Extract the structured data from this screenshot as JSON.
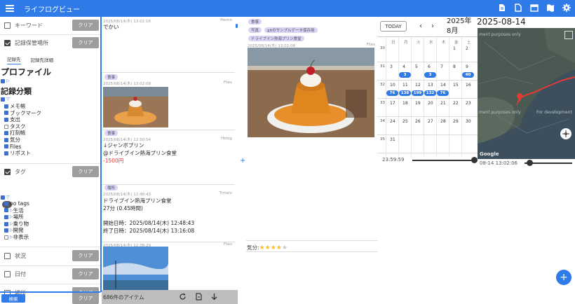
{
  "app": {
    "title": "ライフログビュー"
  },
  "filters": {
    "keyword": {
      "label": "キーワード",
      "checked": false
    },
    "storage": {
      "label": "記録保管場所",
      "checked": true
    },
    "tag": {
      "label": "タグ",
      "checked": true
    },
    "status": {
      "label": "状況",
      "checked": false
    },
    "date": {
      "label": "日付",
      "checked": false
    },
    "place": {
      "label": "場所",
      "checked": false
    },
    "clear_label": "クリア",
    "tab_storage": "記録先",
    "tab_storage_detail": "記録先詳細",
    "profile_heading": "プロファイル",
    "category_heading": "記録分類",
    "categories": [
      "メモ帳",
      "ブックマーク",
      "支出",
      "タスク",
      "打刻帳",
      "気分",
      "Files",
      "リポスト"
    ],
    "tags": [
      "no tags",
      "生活",
      "場所",
      "乗り物",
      "開発",
      "非表示"
    ],
    "search_label": "検索"
  },
  "timeline": {
    "count_label": "686件のアイテム",
    "cards": [
      {
        "ts": "2025/08/14(木) 13:02:16",
        "source": "Memo",
        "text": "でかい"
      },
      {
        "ts": "2025/08/14(木) 13:02:08",
        "source": "Files",
        "chip": "食事"
      },
      {
        "ts": "2025/08/14(木) 12:50:54",
        "source": "Hblog",
        "chip": "食事",
        "line1": "↓ジャンボプリン",
        "line2": "@ドライブイン熱海プリン食堂",
        "amount": "-1500円"
      },
      {
        "ts": "2025/08/14(木) 12:48:43",
        "source": "Timelo",
        "chip": "場所",
        "line1": "ドライブイン熱海プリン食堂",
        "line2": "27分 (0.45時間)",
        "start": "開始日時：2025/08/14(木) 12:48:43",
        "end": "終了日時：2025/08/14(木) 13:16:08"
      },
      {
        "ts": "2025/08/14(木) 12:38:29",
        "source": "Files"
      }
    ]
  },
  "detail": {
    "chips": [
      "食事",
      "写真",
      "gitのサンプルデータ保存用",
      "ドライブイン熱海プリン食堂"
    ],
    "ts": "2025/08/14(木) 13:02:08",
    "source": "Files",
    "mood_label": "気分:",
    "mood_stars": 4,
    "mood_max": 5
  },
  "calendar": {
    "today_label": "TODAY",
    "prev": "‹",
    "next": "›",
    "year_month": "2025年8月",
    "selected_date": "2025-08-14",
    "weekdays": [
      "日",
      "月",
      "火",
      "水",
      "木",
      "金",
      "土"
    ],
    "weeks": [
      {
        "num": "30",
        "days": [
          "",
          "",
          "",
          "",
          "",
          "1",
          "2"
        ]
      },
      {
        "num": "31",
        "days": [
          "3",
          "4",
          "5",
          "6",
          "7",
          "8",
          "9"
        ]
      },
      {
        "num": "32",
        "days": [
          "10",
          "11",
          "12",
          "13",
          "14",
          "15",
          "16"
        ]
      },
      {
        "num": "33",
        "days": [
          "17",
          "18",
          "19",
          "20",
          "21",
          "22",
          "23"
        ]
      },
      {
        "num": "34",
        "days": [
          "24",
          "25",
          "26",
          "27",
          "28",
          "29",
          "30"
        ]
      },
      {
        "num": "35",
        "days": [
          "31",
          "",
          "",
          "",
          "",
          "",
          ""
        ]
      }
    ],
    "counts": [
      {
        "week": 1,
        "day": 1,
        "value": "3"
      },
      {
        "week": 1,
        "day": 3,
        "value": "3"
      },
      {
        "week": 1,
        "day": 6,
        "value": "40"
      },
      {
        "week": 2,
        "day": 0,
        "value": "76"
      },
      {
        "week": 2,
        "day": 1,
        "value": "138"
      },
      {
        "week": 2,
        "day": 2,
        "value": "199"
      },
      {
        "week": 2,
        "day": 3,
        "value": "132"
      },
      {
        "week": 2,
        "day": 4,
        "value": "76"
      }
    ],
    "time_end": "23:59:59",
    "time_point": "08-14 13:02:06"
  },
  "map": {
    "watermark1": "ment purposes only",
    "watermark2": "For development",
    "google": "Google"
  },
  "colors": {
    "accent": "#2f7be8",
    "chip": "#d7d4f5",
    "clear": "#9e9e9e"
  }
}
